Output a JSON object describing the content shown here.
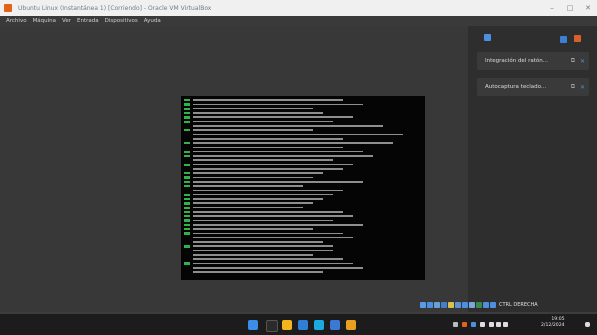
{
  "window": {
    "title": "Ubuntu Linux (Instantánea 1) [Corriendo] - Oracle VM VirtualBox",
    "controls": [
      "–",
      "□",
      "✕"
    ]
  },
  "menubar": {
    "items": [
      "Archivo",
      "Máquina",
      "Ver",
      "Entrada",
      "Dispositivos",
      "Ayuda"
    ]
  },
  "side_panel": {
    "notifications": [
      {
        "label": "Integración del ratón...",
        "pin": "⧉",
        "close": "✕"
      },
      {
        "label": "Autocaptura teclado...",
        "pin": "⧉",
        "close": "✕"
      }
    ]
  },
  "statusbar": {
    "host_key": "CTRL DERECHA"
  },
  "taskbar": {
    "clock_time": "19:05",
    "clock_date": "2/12/2024"
  },
  "colors": {
    "ok": "#2fb34a",
    "console_bg": "#050505",
    "accent": "#4d8fe0"
  }
}
